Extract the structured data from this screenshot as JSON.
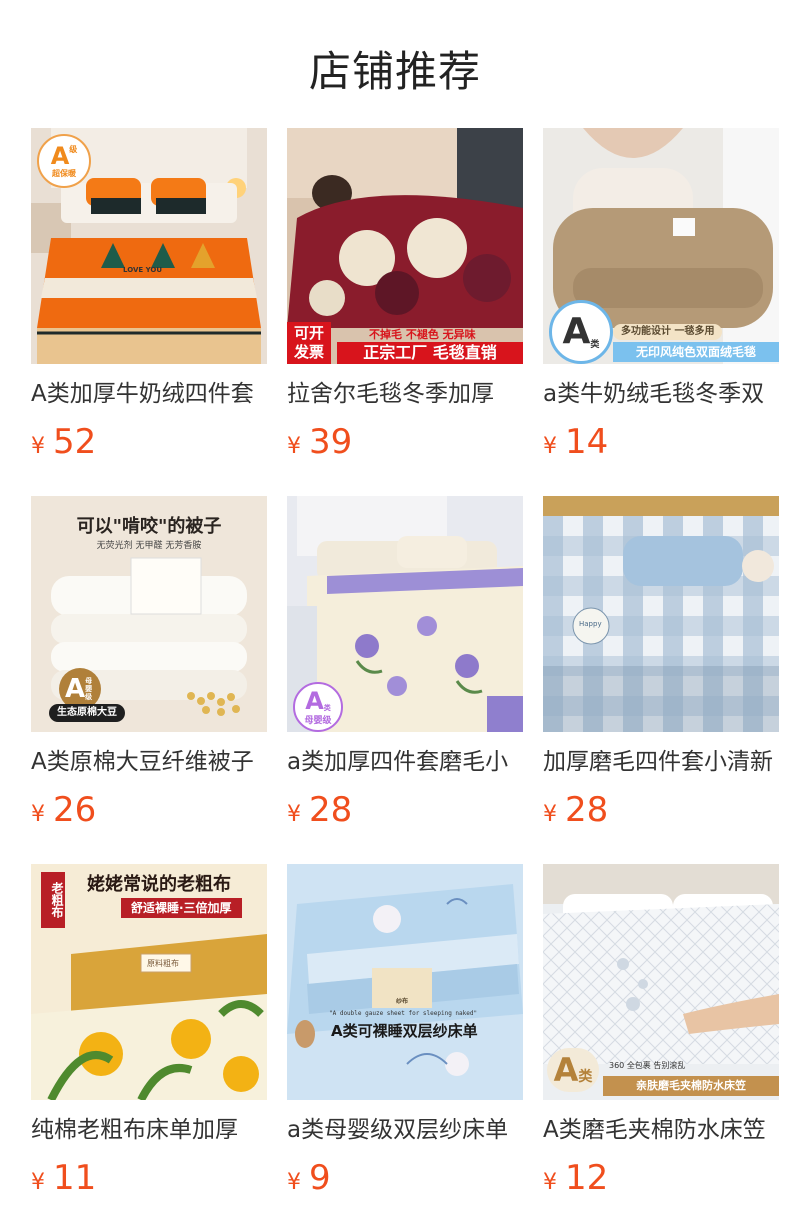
{
  "page": {
    "title": "店铺推荐"
  },
  "currency": "¥",
  "products": [
    {
      "name": "A类加厚牛奶绒四件套",
      "price": "52",
      "image": {
        "badge_letter": "A",
        "badge_small": "级",
        "badge_sub": "超保暖",
        "bed_text": "LOVE YOU"
      }
    },
    {
      "name": "拉舍尔毛毯冬季加厚",
      "price": "39",
      "image": {
        "left_tag_1": "可开",
        "left_tag_2": "发票",
        "top_line": "不掉毛 不褪色 无异味",
        "banner": "正宗工厂 毛毯直销"
      }
    },
    {
      "name": "a类牛奶绒毛毯冬季双",
      "price": "14",
      "image": {
        "badge_letter": "A",
        "badge_small": "类",
        "line_1": "多功能设计 一毯多用",
        "line_2": "无印风纯色双面绒毛毯"
      }
    },
    {
      "name": "A类原棉大豆纤维被子",
      "price": "26",
      "image": {
        "headline": "可以\"啃咬\"的被子",
        "subline": "无荧光剂 无甲醛 无芳香胺",
        "badge_letter": "A",
        "badge_small": "母婴级",
        "tag": "生态原棉大豆"
      }
    },
    {
      "name": "a类加厚四件套磨毛小",
      "price": "28",
      "image": {
        "badge_letter": "A",
        "badge_small": "类",
        "badge_sub": "母婴级"
      }
    },
    {
      "name": "加厚磨毛四件套小清新",
      "price": "28",
      "image": {
        "pillow_text": "Happy"
      }
    },
    {
      "name": "纯棉老粗布床单加厚",
      "price": "11",
      "image": {
        "headline": "姥姥常说的老粗布",
        "ribbon": "舒适裸睡·三倍加厚",
        "side_tag": "老粗布",
        "label": "原料粗布"
      }
    },
    {
      "name": "a类母婴级双层纱床单",
      "price": "9",
      "image": {
        "small_line": "\"A double gauze sheet for sleeping naked\"",
        "headline": "A类可裸睡双层纱床单",
        "label": "纱布"
      }
    },
    {
      "name": "A类磨毛夹棉防水床笠",
      "price": "12",
      "image": {
        "badge_letter": "A",
        "badge_small": "类",
        "line_1": "360 全包裹 告别滚乱",
        "line_2": "亲肤磨毛夹棉防水床笠"
      }
    }
  ],
  "colors": {
    "accent_price": "#f04e1d",
    "text": "#333333"
  }
}
